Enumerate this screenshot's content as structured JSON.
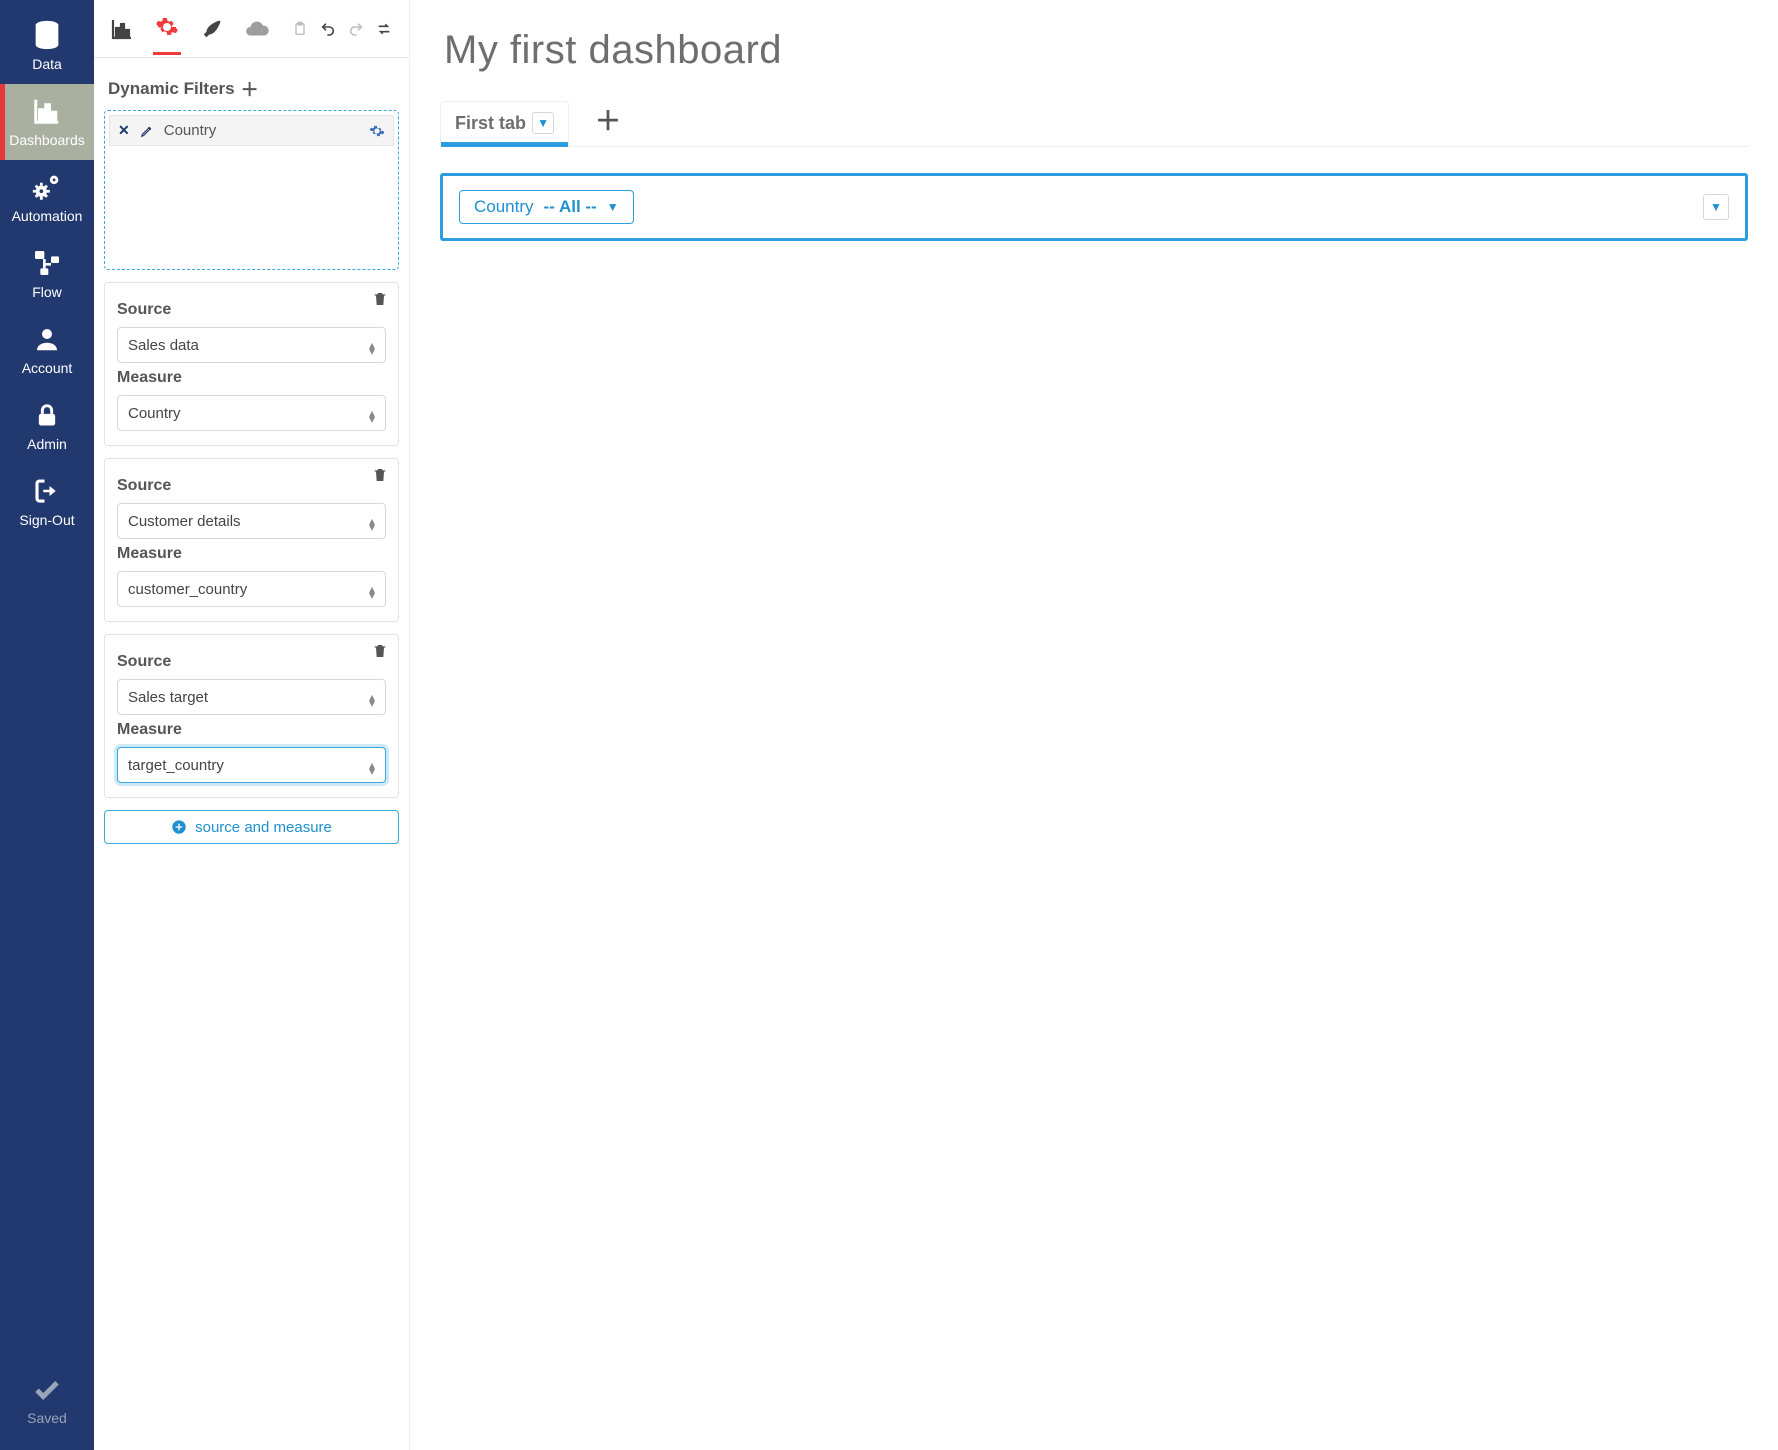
{
  "rail": {
    "items": [
      {
        "key": "data",
        "label": "Data"
      },
      {
        "key": "dashboards",
        "label": "Dashboards",
        "active": true
      },
      {
        "key": "automation",
        "label": "Automation"
      },
      {
        "key": "flow",
        "label": "Flow"
      },
      {
        "key": "account",
        "label": "Account"
      },
      {
        "key": "admin",
        "label": "Admin"
      },
      {
        "key": "signout",
        "label": "Sign-Out"
      }
    ],
    "saved_label": "Saved"
  },
  "toolstrip": {
    "active_index": 1
  },
  "config": {
    "dynamic_filters_label": "Dynamic Filters",
    "filter_chip": {
      "label": "Country"
    },
    "blocks": [
      {
        "source_label": "Source",
        "source_value": "Sales data",
        "measure_label": "Measure",
        "measure_value": "Country",
        "focused": false
      },
      {
        "source_label": "Source",
        "source_value": "Customer details",
        "measure_label": "Measure",
        "measure_value": "customer_country",
        "focused": false
      },
      {
        "source_label": "Source",
        "source_value": "Sales target",
        "measure_label": "Measure",
        "measure_value": "target_country",
        "focused": true
      }
    ],
    "add_button_label": "source and measure"
  },
  "main": {
    "title": "My first dashboard",
    "tab_label": "First tab",
    "filter_pill": {
      "field": "Country",
      "value": "-- All --"
    }
  }
}
